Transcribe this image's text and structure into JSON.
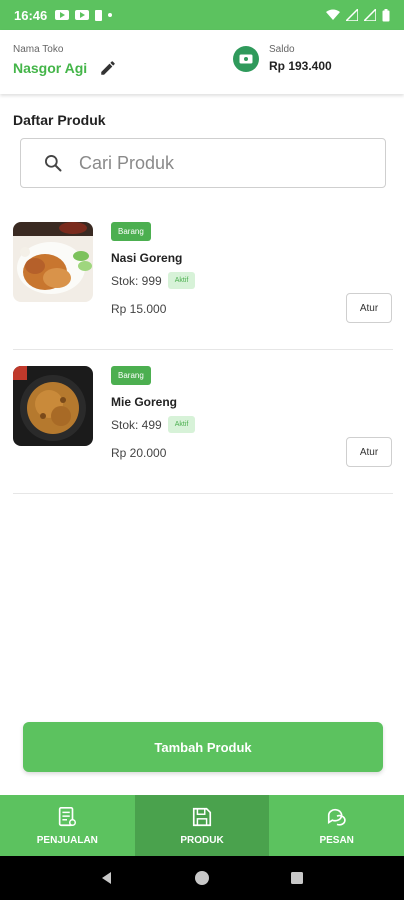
{
  "status_bar": {
    "time": "16:46"
  },
  "header": {
    "store_label": "Nama Toko",
    "store_name": "Nasgor Agi",
    "saldo_label": "Saldo",
    "saldo_value": "Rp 193.400"
  },
  "section_title": "Daftar Produk",
  "search": {
    "placeholder": "Cari Produk",
    "value": ""
  },
  "products": [
    {
      "category": "Barang",
      "name": "Nasi Goreng",
      "stock": "Stok: 999",
      "status": "Aktif",
      "price": "Rp 15.000",
      "action_label": "Atur",
      "image_icon": "fried-rice-photo"
    },
    {
      "category": "Barang",
      "name": "Mie Goreng",
      "stock": "Stok: 499",
      "status": "Aktif",
      "price": "Rp 20.000",
      "action_label": "Atur",
      "image_icon": "fried-noodles-photo"
    }
  ],
  "add_button_label": "Tambah Produk",
  "bottom_nav": [
    {
      "label": "PENJUALAN",
      "icon": "receipt-icon",
      "active": false
    },
    {
      "label": "PRODUK",
      "icon": "save-icon",
      "active": true
    },
    {
      "label": "PESAN",
      "icon": "chat-icon",
      "active": false
    }
  ],
  "colors": {
    "brand": "#5cc25f",
    "brand_dark": "#4aa24d",
    "store_name": "#44b549",
    "badge": "#4caf50",
    "status_bg": "#d7f2d8",
    "wallet": "#2f9a5b"
  }
}
